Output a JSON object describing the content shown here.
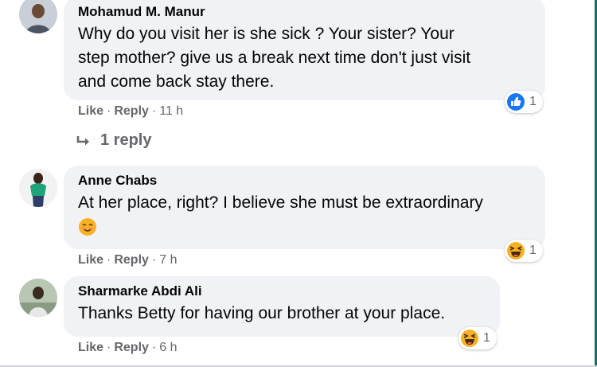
{
  "colors": {
    "bubble": "#f0f2f5",
    "text": "#050505",
    "secondary": "#65676b",
    "like_blue": "#1877f2",
    "haha_yellow": "#f7b125"
  },
  "comments": [
    {
      "author": "Mohamud M. Manur",
      "lines": [
        "Why do you visit her is she sick ? Your sister? Your",
        "step mother? give us a break next time don't just visit",
        "and come back stay there."
      ],
      "reaction": {
        "icon": "like-icon",
        "count": "1"
      },
      "actions": {
        "like": "Like",
        "reply": "Reply",
        "time": "11 h"
      },
      "replies_link": "1 reply"
    },
    {
      "author": "Anne Chabs",
      "lines": [
        "At her place, right? I believe she must be extraordinary"
      ],
      "inline_emoji": "smiling-face-emoji",
      "reaction": {
        "icon": "haha-icon",
        "count": "1"
      },
      "actions": {
        "like": "Like",
        "reply": "Reply",
        "time": "7 h"
      }
    },
    {
      "author": "Sharmarke Abdi Ali",
      "lines": [
        "Thanks Betty for having our brother at your place."
      ],
      "reaction": {
        "icon": "haha-icon",
        "count": "1"
      },
      "actions": {
        "like": "Like",
        "reply": "Reply",
        "time": "6 h"
      }
    }
  ],
  "separator": "·"
}
